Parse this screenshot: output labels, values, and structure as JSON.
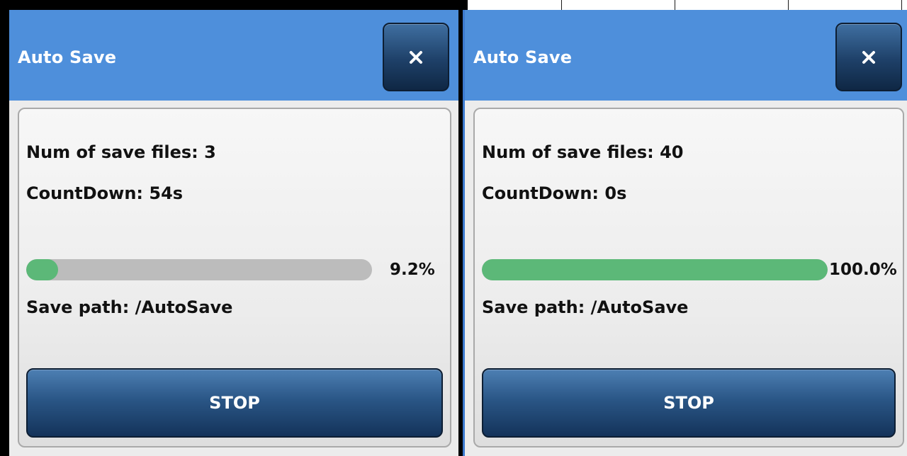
{
  "dialogs": [
    {
      "title": "Auto Save",
      "close_icon": "close-icon",
      "files_text": "Num of save files: 3",
      "countdown_text": "CountDown: 54s",
      "progress": {
        "value": 0.092,
        "label": "9.2%"
      },
      "path_text": "Save path: /AutoSave",
      "stop_label": "STOP"
    },
    {
      "title": "Auto Save",
      "close_icon": "close-icon",
      "files_text": "Num of save files: 40",
      "countdown_text": "CountDown: 0s",
      "progress": {
        "value": 1.0,
        "label": "100.0%"
      },
      "path_text": "Save path: /AutoSave",
      "stop_label": "STOP"
    }
  ],
  "colors": {
    "title_bar": "#4e8fdb",
    "progress_fill": "#5cb878",
    "progress_track": "#bcbcbc",
    "button_dark": "#1e4068"
  }
}
